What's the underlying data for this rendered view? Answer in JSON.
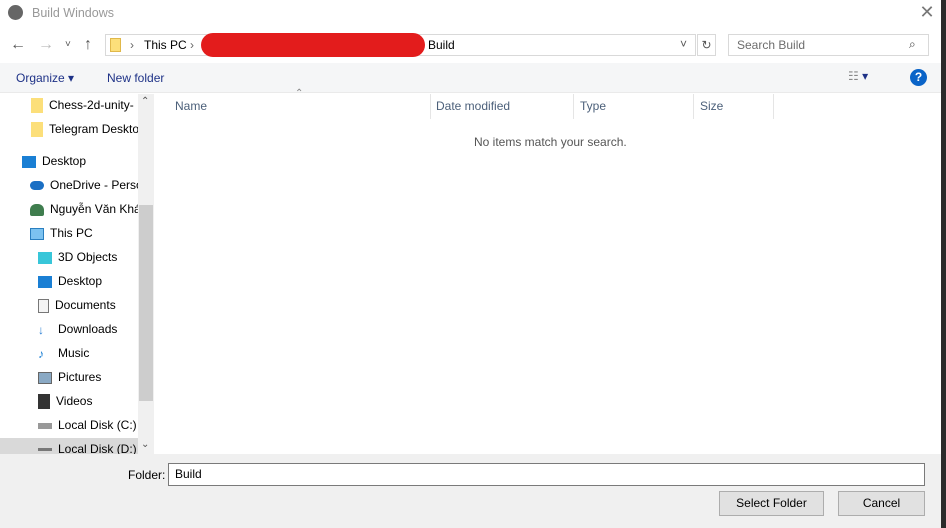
{
  "window": {
    "title": "Build Windows"
  },
  "address": {
    "crumbs": [
      "This PC",
      "Build"
    ]
  },
  "search": {
    "placeholder": "Search Build"
  },
  "toolbar": {
    "organize": "Organize",
    "new_folder": "New folder"
  },
  "sidebar": {
    "items": [
      {
        "label": "Chess-2d-unity-",
        "icon": "folder-icon"
      },
      {
        "label": "Telegram Deskto",
        "icon": "folder-icon"
      },
      {
        "label": "Desktop",
        "icon": "desktop-icon"
      },
      {
        "label": "OneDrive - Perso",
        "icon": "cloud-icon"
      },
      {
        "label": "Nguyễn Văn Khá",
        "icon": "user-icon"
      },
      {
        "label": "This PC",
        "icon": "computer-icon"
      },
      {
        "label": "3D Objects",
        "icon": "cube-icon"
      },
      {
        "label": "Desktop",
        "icon": "desktop-icon"
      },
      {
        "label": "Documents",
        "icon": "document-icon"
      },
      {
        "label": "Downloads",
        "icon": "download-icon"
      },
      {
        "label": "Music",
        "icon": "music-icon"
      },
      {
        "label": "Pictures",
        "icon": "picture-icon"
      },
      {
        "label": "Videos",
        "icon": "video-icon"
      },
      {
        "label": "Local Disk (C:)",
        "icon": "drive-icon"
      },
      {
        "label": "Local Disk (D:)",
        "icon": "drive-icon"
      }
    ]
  },
  "columns": [
    "Name",
    "Date modified",
    "Type",
    "Size"
  ],
  "empty_message": "No items match your search.",
  "footer": {
    "folder_label": "Folder:",
    "folder_value": "Build",
    "select": "Select Folder",
    "cancel": "Cancel"
  }
}
